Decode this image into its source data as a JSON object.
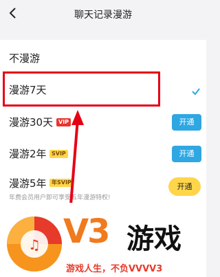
{
  "header": {
    "title": "聊天记录漫游",
    "back_icon": "chevron-left-icon"
  },
  "options": [
    {
      "label": "不漫游"
    },
    {
      "label": "漫游7天",
      "selected": true
    },
    {
      "label": "漫游30天",
      "badge": "VIP",
      "action": "开通"
    },
    {
      "label": "漫游2年",
      "badge": "SVIP",
      "action": "开通"
    },
    {
      "label": "漫游5年",
      "badge": "年SVIP",
      "action": "开通"
    }
  ],
  "note": "年费会员用户即可享受五年漫游特权!",
  "colors": {
    "highlight": "#e60012",
    "accent_blue": "#2fa7e2",
    "badge_vip": "#e8352f",
    "badge_svip": "#ffd54a"
  },
  "watermark": {
    "brand": "V3",
    "name": "游戏",
    "slogan": "游戏人生，不负VVVV3"
  }
}
